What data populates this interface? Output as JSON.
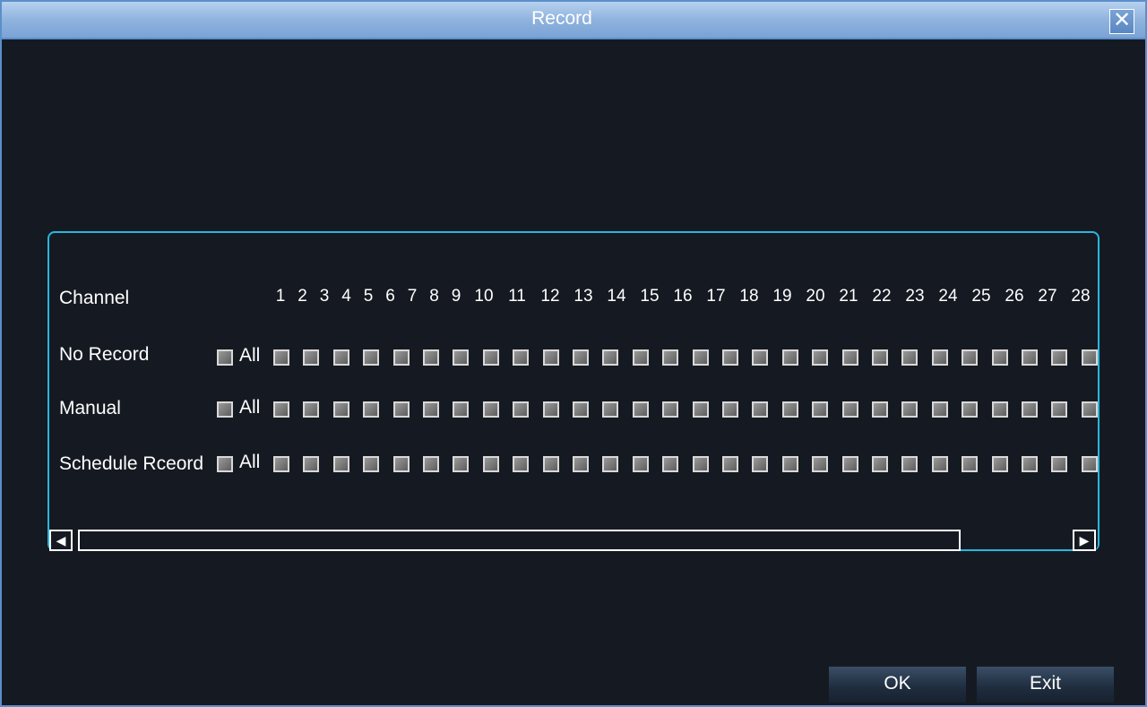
{
  "window": {
    "title": "Record",
    "close_symbol": "✕"
  },
  "rows": {
    "channel_label": "Channel",
    "no_record_label": "No Record",
    "manual_label": "Manual",
    "schedule_label": "Schedule Rceord",
    "all_label": "All"
  },
  "channels": [
    "1",
    "2",
    "3",
    "4",
    "5",
    "6",
    "7",
    "8",
    "9",
    "10",
    "11",
    "12",
    "13",
    "14",
    "15",
    "16",
    "17",
    "18",
    "19",
    "20",
    "21",
    "22",
    "23",
    "24",
    "25",
    "26",
    "27",
    "28"
  ],
  "scrollbar": {
    "left_arrow": "◀",
    "right_arrow": "▶"
  },
  "buttons": {
    "ok": "OK",
    "exit": "Exit"
  },
  "colors": {
    "accent": "#29b6e0",
    "titlebar": "#8fb3de",
    "background": "#151a22"
  }
}
